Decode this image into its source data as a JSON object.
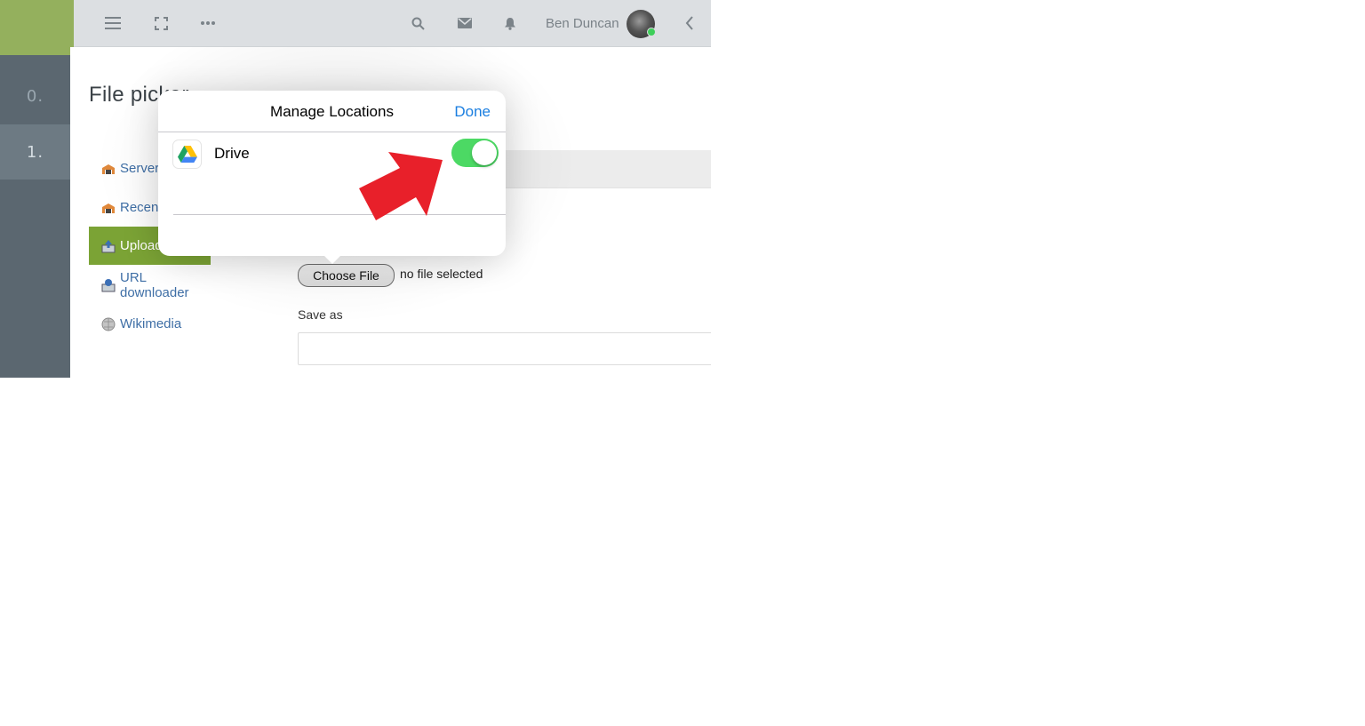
{
  "rail": {
    "items": [
      "0.",
      "1."
    ]
  },
  "topbar": {
    "icons": [
      "hamburger-menu-icon",
      "fullscreen-icon",
      "more-dots-icon",
      "search-icon",
      "mail-icon",
      "bell-icon",
      "chevron-left-icon"
    ],
    "user_name": "Ben Duncan"
  },
  "page": {
    "title": "File picker",
    "sidebar": [
      {
        "label": "Server",
        "icon": "repository-icon"
      },
      {
        "label": "Recent",
        "icon": "repository-icon"
      },
      {
        "label": "Upload",
        "icon": "upload-icon",
        "active": true
      },
      {
        "label": "URL downloader",
        "icon": "url-download-icon"
      },
      {
        "label": "Wikimedia",
        "icon": "wikimedia-icon"
      }
    ],
    "upload": {
      "choose_file_label": "Choose File",
      "no_file_text": "no file selected",
      "save_as_label": "Save as",
      "save_as_value": ""
    }
  },
  "popover": {
    "title": "Manage Locations",
    "done_label": "Done",
    "locations": [
      {
        "label": "Drive",
        "enabled": true,
        "icon": "google-drive-icon"
      }
    ]
  },
  "colors": {
    "accent_green": "#7ba335",
    "rail": "#5b6770",
    "toggle_on": "#4cd964",
    "ios_blue": "#1a7ee0",
    "annotation_arrow": "#e8202a"
  }
}
